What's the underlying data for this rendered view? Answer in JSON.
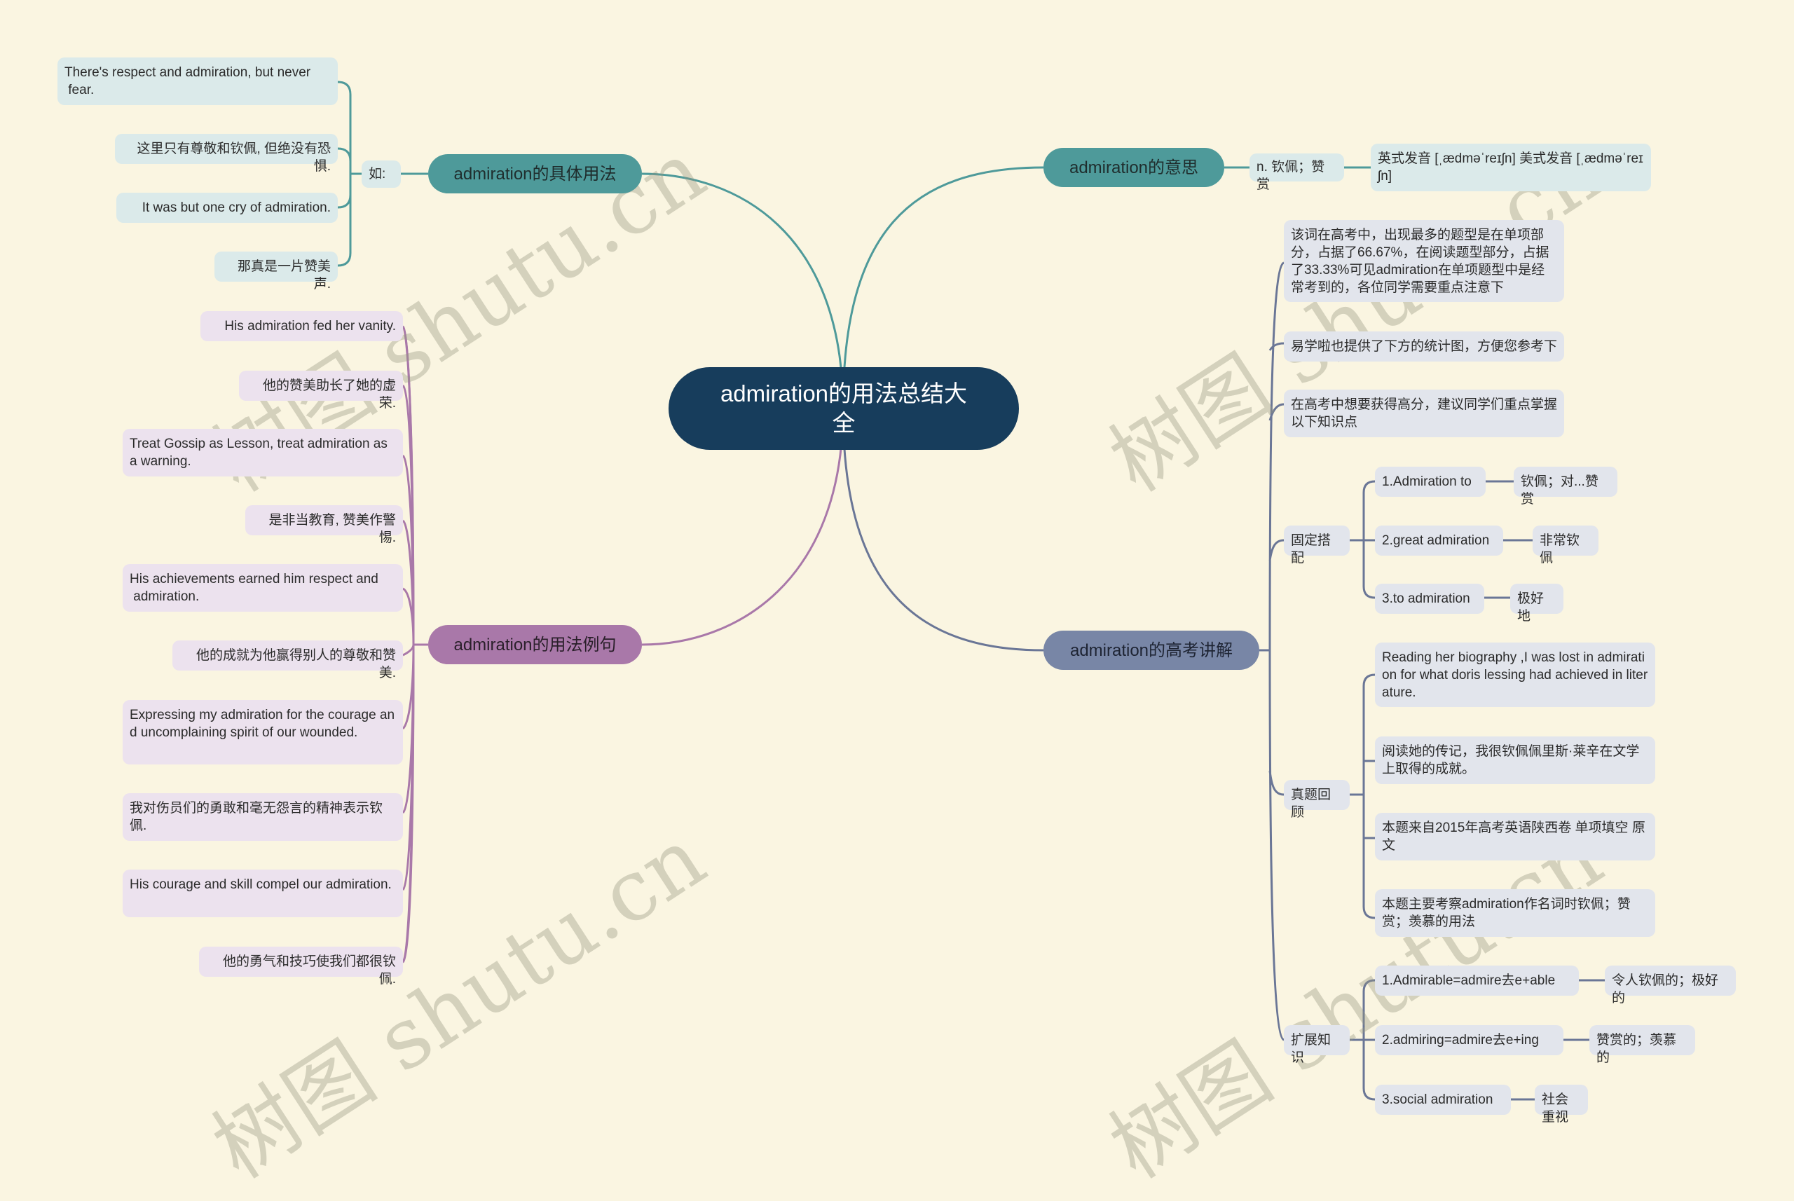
{
  "title": "admiration的用法总结大全",
  "colors": {
    "background": "#faf5e1",
    "root": "#173d5c",
    "teal": "#4e9a9a",
    "purple": "#a978a9",
    "slate": "#7886a6"
  },
  "branches": {
    "usage": {
      "label": "admiration的具体用法",
      "sub_label": "如:",
      "examples": [
        "There's respect and admiration, but never\n fear.",
        "这里只有尊敬和钦佩, 但绝没有恐惧.",
        "It was but one cry of admiration.",
        "那真是一片赞美声."
      ]
    },
    "meaning": {
      "label": "admiration的意思",
      "definition": "n. 钦佩；赞赏",
      "pronunciation": "英式发音 [ˌædməˈreɪʃn] 美式发音 [ˌædməˈreɪʃn]"
    },
    "sentences": {
      "label": "admiration的用法例句",
      "items": [
        "His admiration fed her vanity.",
        "他的赞美助长了她的虚荣.",
        "Treat Gossip as Lesson, treat admiration as a warning.",
        "是非当教育, 赞美作警惕.",
        "His achievements earned him respect and\n admiration.",
        "他的成就为他赢得别人的尊敬和赞美.",
        "Expressing my admiration for the courage and uncomplaining spirit of our wounded.",
        "我对伤员们的勇敢和毫无怨言的精神表示钦佩.",
        "His courage and skill compel our admiration.",
        "他的勇气和技巧使我们都很钦佩."
      ]
    },
    "exam": {
      "label": "admiration的高考讲解",
      "notes": [
        "该词在高考中，出现最多的题型是在单项部分，占据了66.67%，在阅读题型部分，占据了33.33%可见admiration在单项题型中是经常考到的，各位同学需要重点注意下",
        "易学啦也提供了下方的统计图，方便您参考下",
        "在高考中想要获得高分，建议同学们重点掌握以下知识点"
      ],
      "collocations": {
        "label": "固定搭配",
        "items": [
          {
            "term": "1.Admiration to",
            "meaning": "钦佩；对...赞赏"
          },
          {
            "term": "2.great admiration",
            "meaning": "非常钦佩"
          },
          {
            "term": "3.to admiration",
            "meaning": "极好地"
          }
        ]
      },
      "review": {
        "label": "真题回顾",
        "items": [
          "Reading her biography ,I was lost in admiration for what doris lessing had achieved in literature.",
          "阅读她的传记，我很钦佩佩里斯·莱辛在文学上取得的成就。",
          "本题来自2015年高考英语陕西卷 单项填空 原文",
          "本题主要考察admiration作名词时钦佩；赞赏；羡慕的用法"
        ]
      },
      "extension": {
        "label": "扩展知识",
        "items": [
          {
            "term": "1.Admirable=admire去e+able",
            "meaning": "令人钦佩的；极好的"
          },
          {
            "term": "2.admiring=admire去e+ing",
            "meaning": "赞赏的；羡慕的"
          },
          {
            "term": "3.social admiration",
            "meaning": "社会重视"
          }
        ]
      }
    }
  },
  "watermark": "树图 shutu.cn"
}
